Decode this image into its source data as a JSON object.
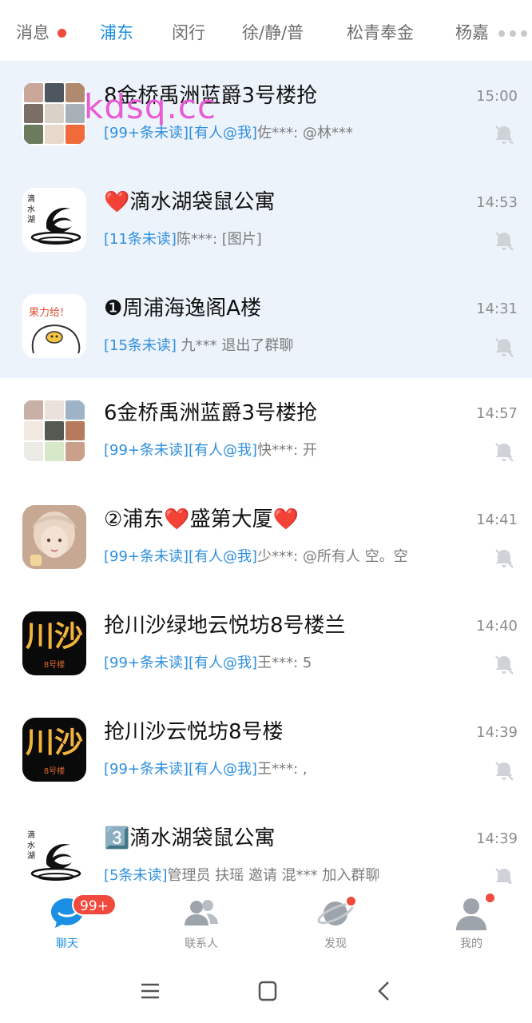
{
  "tabs": [
    {
      "label": "消息",
      "has_dot": true
    },
    {
      "label": "浦东",
      "active": true
    },
    {
      "label": "闵行"
    },
    {
      "label": "徐/静/普"
    },
    {
      "label": "松青奉金"
    },
    {
      "label": "杨嘉"
    }
  ],
  "watermark": "kdsq.cc",
  "chats": [
    {
      "title": "8金桥禹洲蓝爵3号楼抢",
      "time": "15:00",
      "tag": "[99+条未读][有人@我]",
      "text": "佐***: @林***",
      "pinned": true,
      "muted": true
    },
    {
      "title": "❤️滴水湖袋鼠公寓",
      "time": "14:53",
      "tag": "[11条未读]",
      "text": "陈***: [图片]",
      "pinned": true,
      "muted": true
    },
    {
      "title": "❶周浦海逸阁A楼",
      "time": "14:31",
      "tag": "[15条未读]",
      "text": " 九***  退出了群聊",
      "pinned": true,
      "muted": true
    },
    {
      "title": "6金桥禹洲蓝爵3号楼抢",
      "time": "14:57",
      "tag": "[99+条未读][有人@我]",
      "text": "快***: 开",
      "pinned": false,
      "muted": true
    },
    {
      "title": "②浦东❤️盛第大厦❤️",
      "time": "14:41",
      "tag": "[99+条未读][有人@我]",
      "text": "少***: @所有人 空。空",
      "pinned": false,
      "muted": true
    },
    {
      "title": "抢川沙绿地云悦坊8号楼兰",
      "time": "14:40",
      "tag": "[99+条未读][有人@我]",
      "text": "王***: 5",
      "pinned": false,
      "muted": true
    },
    {
      "title": "抢川沙云悦坊8号楼",
      "time": "14:39",
      "tag": "[99+条未读][有人@我]",
      "text": "王***: ,",
      "pinned": false,
      "muted": true
    },
    {
      "title": "3️⃣滴水湖袋鼠公寓",
      "time": "14:39",
      "tag": "[5条未读]",
      "text": "管理员 扶瑶  邀请  混***  加入群聊",
      "pinned": false,
      "muted": true
    }
  ],
  "avatars": {
    "dishuihu_text": "滴\n水\n湖",
    "guoli_text": "果力给!",
    "chuansha_text": "川沙",
    "chuansha_sub": "8号楼"
  },
  "bottom_nav": [
    {
      "label": "聊天",
      "active": true,
      "badge": "99+"
    },
    {
      "label": "联系人"
    },
    {
      "label": "发现",
      "has_dot": true
    },
    {
      "label": "我的",
      "has_dot": true
    }
  ],
  "colors": {
    "accent": "#1a8fe3",
    "badge_red": "#f04a3e",
    "pinned_bg": "#edf3fb",
    "watermark": "#e85bd4"
  }
}
